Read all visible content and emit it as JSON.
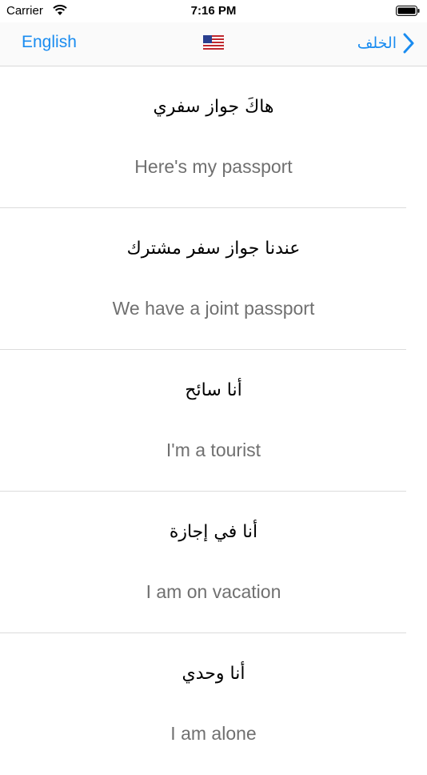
{
  "status_bar": {
    "carrier": "Carrier",
    "time": "7:16 PM"
  },
  "nav": {
    "left_label": "English",
    "flag_icon": "us-flag-icon",
    "back_label": "الخلف",
    "accent_color": "#1a8cf0"
  },
  "phrases": [
    {
      "arabic": "هاكَ جواز سفري",
      "english": "Here's my passport"
    },
    {
      "arabic": "عندنا جواز سفر مشترك",
      "english": "We have a joint passport"
    },
    {
      "arabic": "أنا سائح",
      "english": "I'm a tourist"
    },
    {
      "arabic": "أنا في إجازة",
      "english": "I am on vacation"
    },
    {
      "arabic": "أنا وحدي",
      "english": "I am alone"
    }
  ]
}
